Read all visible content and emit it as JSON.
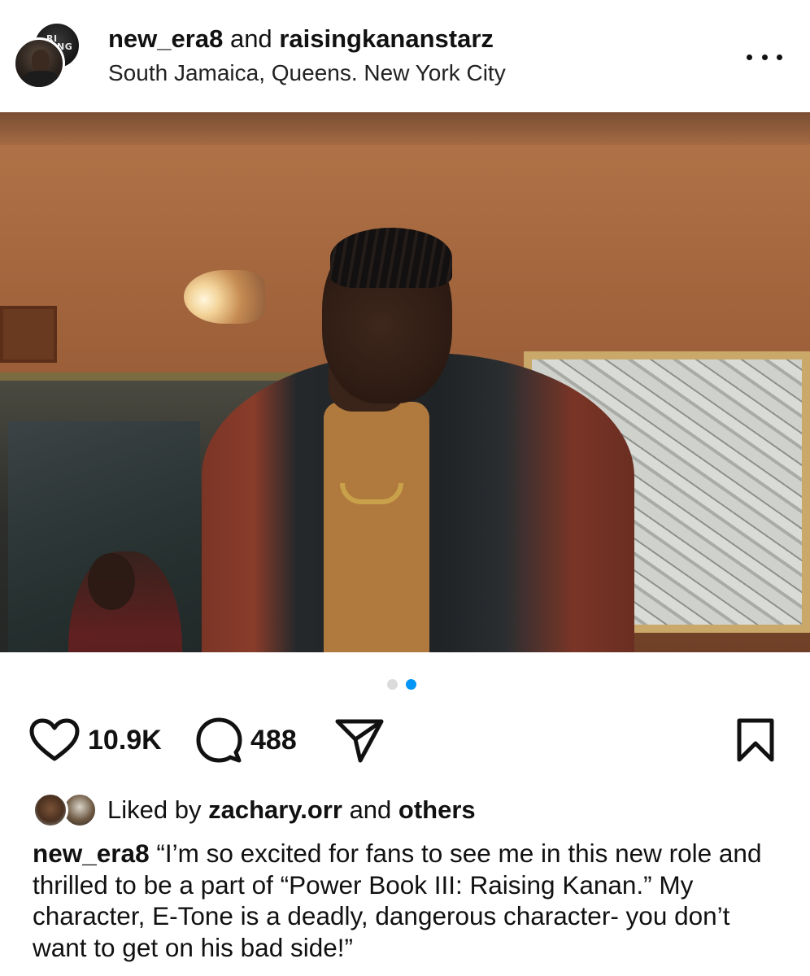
{
  "header": {
    "username_primary": "new_era8",
    "connector": "and",
    "username_secondary": "raisingkananstarz",
    "location": "South Jamaica, Queens. New York City",
    "back_avatar_text": "RISING KAN AN",
    "more_icon": "more-horizontal-icon"
  },
  "carousel": {
    "total": 2,
    "active_index": 1,
    "accent_color": "#0095f6"
  },
  "actions": {
    "like_count": "10.9K",
    "comment_count": "488",
    "like_icon": "heart-icon",
    "comment_icon": "comment-icon",
    "share_icon": "send-icon",
    "save_icon": "bookmark-icon"
  },
  "likes": {
    "prefix": "Liked by",
    "user": "zachary.orr",
    "middle": "and",
    "suffix": "others"
  },
  "caption": {
    "user": "new_era8",
    "text": "“I’m so excited for fans to see me in this new role and thrilled to be a part of “Power Book III: Raising Kanan.” My character, E-Tone is a deadly, dangerous character- you don’t want to get on his bad side!”"
  }
}
